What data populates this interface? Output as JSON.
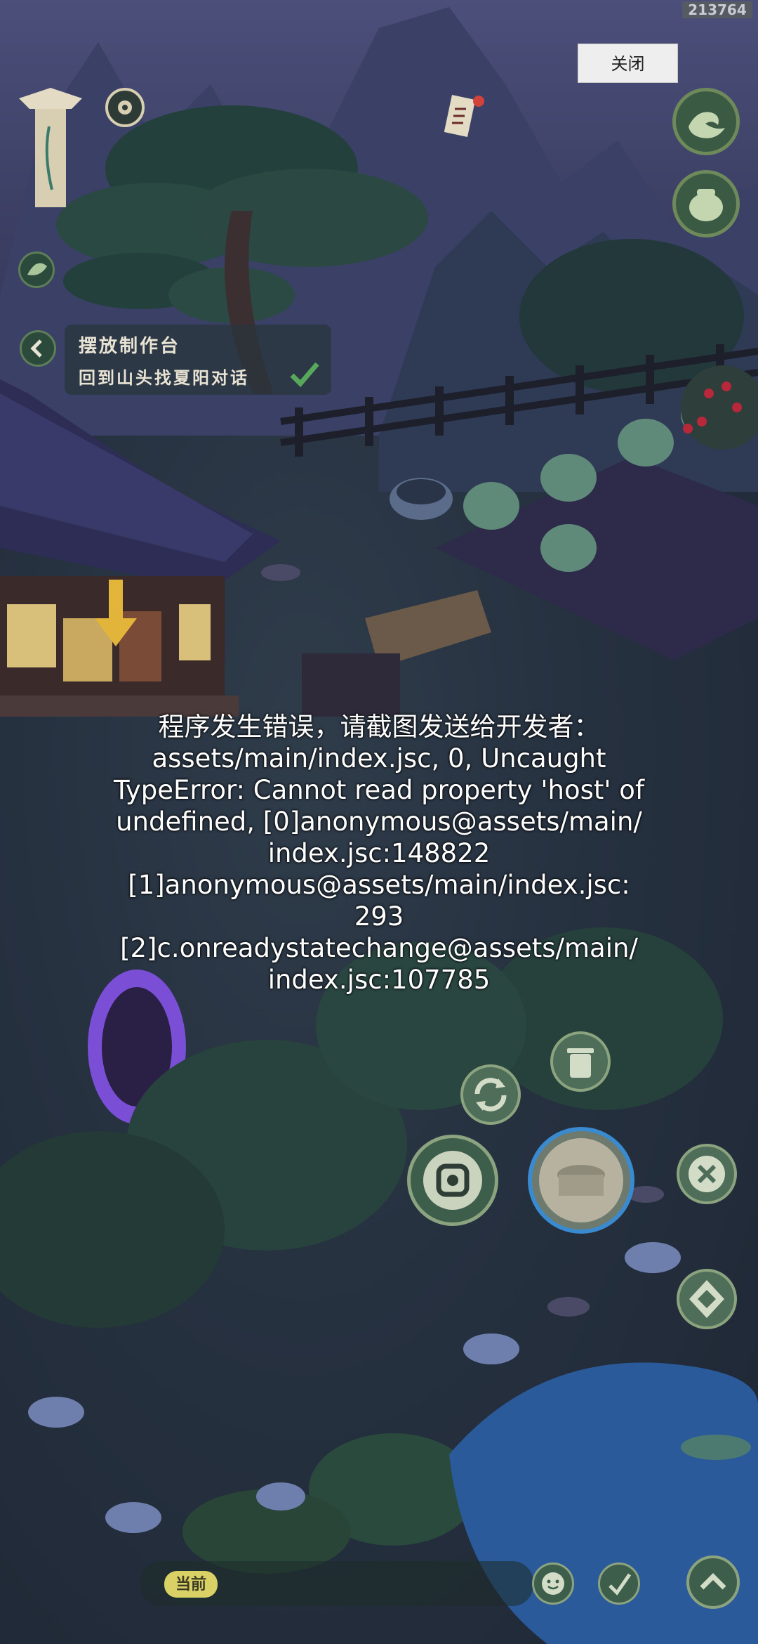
{
  "overlay": {
    "build_id": "213764",
    "close_label": "关闭"
  },
  "quest": {
    "title": "摆放制作台",
    "objective": "回到山头找夏阳对话"
  },
  "error": {
    "lines": [
      "程序发生错误，请截图发送给开发者：",
      "assets/main/index.jsc, 0, Uncaught",
      "TypeError: Cannot read property 'host' of",
      "undefined, [0]anonymous@assets/main/",
      "index.jsc:148822",
      "[1]anonymous@assets/main/index.jsc:",
      "293",
      "[2]c.onreadystatechange@assets/main/",
      "index.jsc:107785"
    ]
  },
  "chat": {
    "channel_label": "当前"
  },
  "icons": {
    "map_scroll": "scroll-icon",
    "compass": "compass-icon",
    "wave_skill": "wave-icon",
    "pot_skill": "pot-icon",
    "leaf": "leaf-icon",
    "trash": "trash-icon",
    "rotate": "rotate-icon",
    "recycle": "recycle-icon",
    "confirm_place": "place-icon",
    "cancel": "close-icon",
    "move": "move-icon",
    "emote": "emote-icon",
    "quick": "quick-icon",
    "expand": "chevron-up-icon"
  },
  "colors": {
    "accent_green": "#4f7a55",
    "portal": "#7a4fd6",
    "water": "#2a5a9a"
  }
}
